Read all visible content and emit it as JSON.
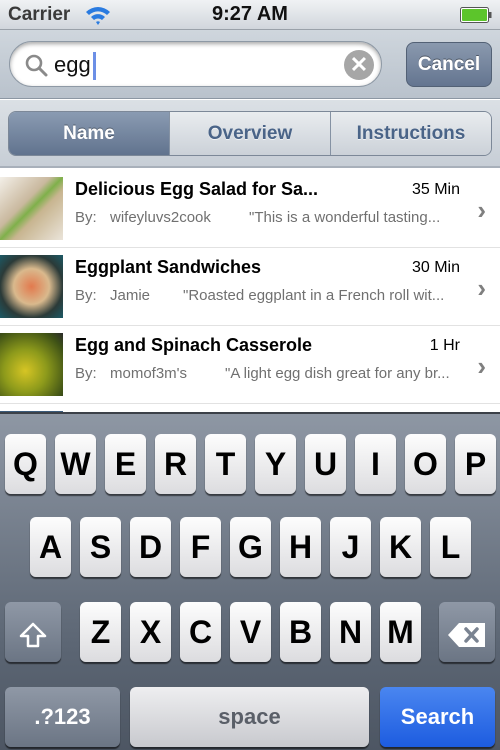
{
  "status_bar": {
    "carrier": "Carrier",
    "time": "9:27 AM",
    "wifi_icon": "wifi-icon",
    "battery_icon": "battery-full-icon",
    "battery_color": "#5cc52b"
  },
  "search": {
    "value": "egg",
    "placeholder": "",
    "search_icon": "search-icon",
    "clear_icon": "clear-icon",
    "clear_glyph": "✕",
    "cancel_label": "Cancel"
  },
  "segments": [
    {
      "label": "Name",
      "active": true
    },
    {
      "label": "Overview",
      "active": false
    },
    {
      "label": "Instructions",
      "active": false
    }
  ],
  "results": [
    {
      "title": "Delicious Egg Salad for Sa...",
      "time": "35 Min",
      "by_label": "By:",
      "author": "wifeyluvs2cook",
      "description": "\"This is a wonderful tasting...",
      "thumbnail": "egg-salad-sandwich-photo"
    },
    {
      "title": "Eggplant Sandwiches",
      "time": "30 Min",
      "by_label": "By:",
      "author": "Jamie",
      "description": "\"Roasted eggplant in a French roll wit...",
      "thumbnail": "eggplant-sandwich-photo"
    },
    {
      "title": "Egg and Spinach Casserole",
      "time": "1 Hr",
      "by_label": "By:",
      "author": "momof3m's",
      "description": "\"A light egg dish great for any br...",
      "thumbnail": "egg-spinach-casserole-photo"
    }
  ],
  "keyboard": {
    "row1": [
      "Q",
      "W",
      "E",
      "R",
      "T",
      "Y",
      "U",
      "I",
      "O",
      "P"
    ],
    "row2": [
      "A",
      "S",
      "D",
      "F",
      "G",
      "H",
      "J",
      "K",
      "L"
    ],
    "row3": [
      "Z",
      "X",
      "C",
      "V",
      "B",
      "N",
      "M"
    ],
    "shift_icon": "shift-icon",
    "delete_icon": "delete-icon",
    "numbers_label": ".?123",
    "space_label": "space",
    "search_label": "Search",
    "search_color": "#2366e6"
  }
}
